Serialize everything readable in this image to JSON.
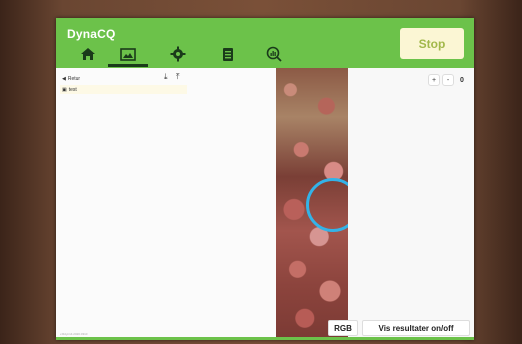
{
  "app": {
    "title": "DynaCQ",
    "stop_label": "Stop",
    "accent_color": "#6cc24a"
  },
  "nav": {
    "icons": [
      "home-icon",
      "image-icon",
      "gear-icon",
      "document-icon",
      "analytics-icon"
    ],
    "active_index": 1
  },
  "file_panel": {
    "back_label": "Retur",
    "file_name": "test",
    "footer_text": "v.Rdyn14.2020.0310"
  },
  "viewer": {
    "zoom_in": "+",
    "zoom_out": "-",
    "zoom_value": "0",
    "rgb_label": "RGB",
    "results_toggle_label": "Vis resultater on/off"
  }
}
